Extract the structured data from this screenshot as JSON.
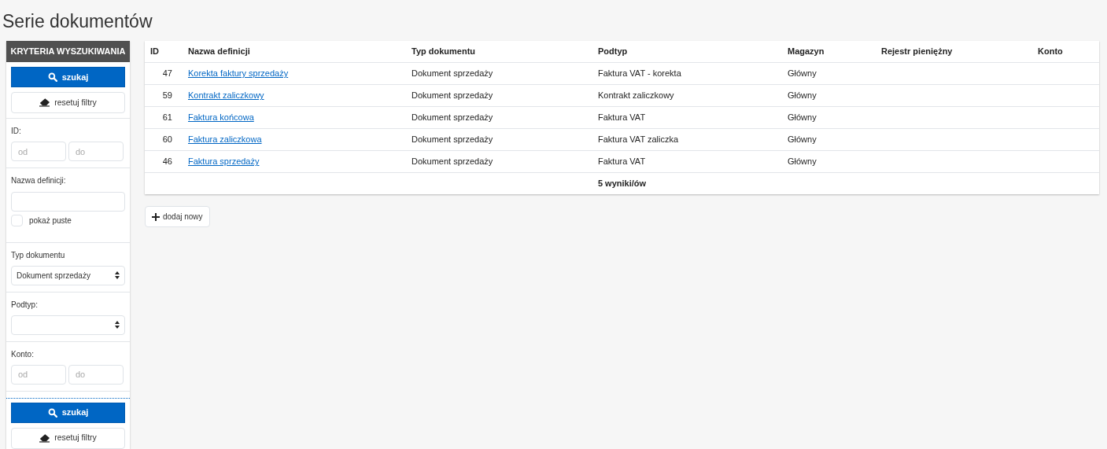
{
  "page_title": "Serie dokumentów",
  "sidebar": {
    "header": "KRYTERIA WYSZUKIWANIA",
    "top_buttons": [
      {
        "kind": "search",
        "label": "szukaj"
      },
      {
        "kind": "reset",
        "label": "resetuj filtry"
      }
    ],
    "filters": [
      {
        "kind": "range",
        "label": "ID:",
        "from_placeholder": "od",
        "to_placeholder": "do"
      },
      {
        "kind": "text",
        "label": "Nazwa definicji:",
        "checkbox": {
          "label": "pokaż puste",
          "checked": false
        }
      },
      {
        "kind": "select",
        "label": "Typ dokumentu",
        "value": "Dokument sprzedaży"
      },
      {
        "kind": "select",
        "label": "Podtyp:"
      },
      {
        "kind": "range",
        "label": "Konto:",
        "from_placeholder": "od",
        "to_placeholder": "do"
      }
    ],
    "bottom_buttons": [
      {
        "kind": "search",
        "label": "szukaj"
      },
      {
        "kind": "reset",
        "label": "resetuj filtry"
      }
    ]
  },
  "table": {
    "columns": [
      "ID",
      "Nazwa definicji",
      "Typ dokumentu",
      "Podtyp",
      "Magazyn",
      "Rejestr pieniężny",
      "Konto"
    ],
    "rows": [
      {
        "id": "47",
        "name": "Korekta faktury sprzedaży",
        "type": "Dokument sprzedaży",
        "subtype": "Faktura VAT - korekta",
        "warehouse": "Główny"
      },
      {
        "id": "59",
        "name": "Kontrakt zaliczkowy",
        "type": "Dokument sprzedaży",
        "subtype": "Kontrakt zaliczkowy",
        "warehouse": "Główny"
      },
      {
        "id": "61",
        "name": "Faktura końcowa",
        "type": "Dokument sprzedaży",
        "subtype": "Faktura VAT",
        "warehouse": "Główny"
      },
      {
        "id": "60",
        "name": "Faktura zaliczkowa",
        "type": "Dokument sprzedaży",
        "subtype": "Faktura VAT zaliczka",
        "warehouse": "Główny"
      },
      {
        "id": "46",
        "name": "Faktura sprzedaży",
        "type": "Dokument sprzedaży",
        "subtype": "Faktura VAT",
        "warehouse": "Główny"
      }
    ],
    "footer": "5 wyniki/ów"
  },
  "add_button": "dodaj nowy"
}
